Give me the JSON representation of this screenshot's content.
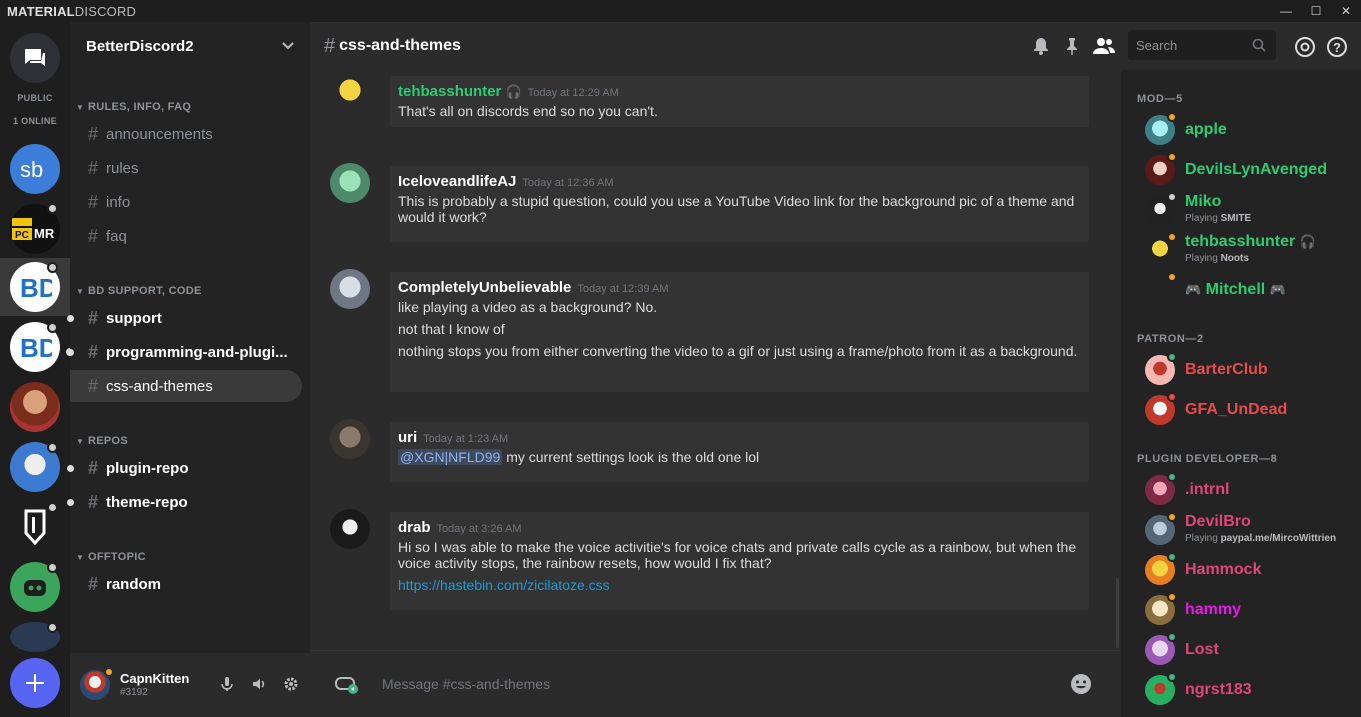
{
  "window": {
    "brand_bold": "MATERIAL",
    "brand_rest": "DISCORD",
    "controls": {
      "minimize": "—",
      "maximize": "☐",
      "close": "✕"
    }
  },
  "guilds": {
    "public_label": "PUBLIC",
    "online_label": "1 ONLINE"
  },
  "server": {
    "name": "BetterDiscord2"
  },
  "categories": {
    "rules": "RULES, INFO, FAQ",
    "support": "BD SUPPORT, CODE",
    "repos": "REPOS",
    "offtopic": "OFFTOPIC"
  },
  "channels": [
    {
      "name": "announcements"
    },
    {
      "name": "rules"
    },
    {
      "name": "info"
    },
    {
      "name": "faq"
    },
    {
      "name": "support"
    },
    {
      "name": "programming-and-plugi..."
    },
    {
      "name": "css-and-themes"
    },
    {
      "name": "plugin-repo"
    },
    {
      "name": "theme-repo"
    },
    {
      "name": "random"
    }
  ],
  "user": {
    "name": "CapnKitten",
    "tag": "#3192"
  },
  "chat": {
    "hash": "#",
    "title": "css-and-themes",
    "search_placeholder": "Search",
    "composer_placeholder": "Message #css-and-themes"
  },
  "messages": [
    {
      "author": "tehbasshunter",
      "timestamp": "Today at 12:29 AM",
      "lines": [
        "That's all on discords end so no you can't."
      ]
    },
    {
      "author": "IceloveandlifeAJ",
      "timestamp": "Today at 12:36 AM",
      "lines": [
        "This is probably a stupid question, could you use a YouTube Video link for the background pic of a theme and would it work?"
      ]
    },
    {
      "author": "CompletelyUnbelievable",
      "timestamp": "Today at 12:39 AM",
      "lines": [
        "like playing a video as a background? No.",
        "not that I know of",
        "nothing stops you from either converting the video to a gif or just using a frame/photo from it as a background."
      ]
    },
    {
      "author": "uri",
      "timestamp": "Today at 1:23 AM",
      "mention": "@XGN|NFLD99",
      "lines": [
        " my current settings look is the old one lol"
      ]
    },
    {
      "author": "drab",
      "timestamp": "Today at 3:26 AM",
      "lines": [
        "Hi so I was able to make the voice activitie's for voice chats and private calls cycle as a rainbow, but when the voice activity stops, the rainbow resets, how would I fix that?"
      ],
      "link": "https://hastebin.com/zicilatoze.css"
    }
  ],
  "member_groups": [
    {
      "title": "MOD—5",
      "members": [
        {
          "name": "apple",
          "color": "#2ecc71",
          "status": "#faa61a"
        },
        {
          "name": "DevilsLynAvenged",
          "color": "#2ecc71",
          "status": "#faa61a"
        },
        {
          "name": "Miko",
          "color": "#2ecc71",
          "status": "#cfcfcf",
          "activity_prefix": "Playing ",
          "activity": "SMITE"
        },
        {
          "name": "tehbasshunter",
          "color": "#2ecc71",
          "status": "#faa61a",
          "activity_prefix": "Playing ",
          "activity": "Noots"
        },
        {
          "name": "Mitchell",
          "color": "#2ecc71",
          "status": "#faa61a"
        }
      ]
    },
    {
      "title": "PATRON—2",
      "members": [
        {
          "name": "BarterClub",
          "color": "#e84b4b",
          "status": "#43b581"
        },
        {
          "name": "GFA_UnDead",
          "color": "#e84b4b",
          "status": "#f04747"
        }
      ]
    },
    {
      "title": "PLUGIN DEVELOPER—8",
      "members": [
        {
          "name": ".intrnl",
          "color": "#e0457b",
          "status": "#43b581"
        },
        {
          "name": "DevilBro",
          "color": "#e0457b",
          "status": "#faa61a",
          "activity_prefix": "Playing ",
          "activity": "paypal.me/MircoWittrien"
        },
        {
          "name": "Hammock",
          "color": "#e0457b",
          "status": "#43b581"
        },
        {
          "name": "hammy",
          "color": "#ea18ea",
          "status": "#faa61a"
        },
        {
          "name": "Lost",
          "color": "#e0457b",
          "status": "#43b581"
        },
        {
          "name": "ngrst183",
          "color": "#e0457b",
          "status": "#43b581"
        }
      ]
    }
  ]
}
